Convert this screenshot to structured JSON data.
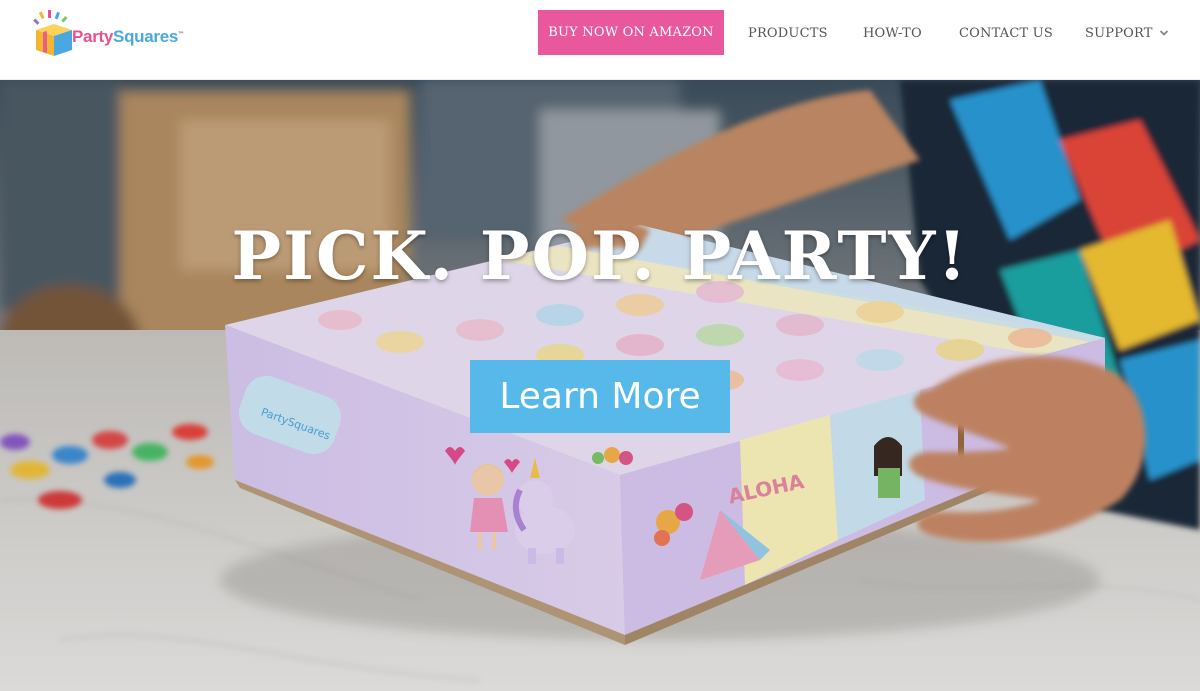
{
  "brand": {
    "logo_part1": "Party",
    "logo_part2": "Squares",
    "trademark": "™",
    "colors": {
      "pink": "#e9589c",
      "blue": "#56b9ea",
      "logo_pink": "#e9508f",
      "logo_blue": "#4aa8e0"
    }
  },
  "nav": {
    "buy_label": "BUY NOW ON AMAZON",
    "products": "PRODUCTS",
    "howto": "HOW-TO",
    "contact": "CONTACT US",
    "support": "SUPPORT",
    "support_icon": "chevron-down-icon"
  },
  "hero": {
    "headline": "PICK. POP. PARTY!",
    "cta_label": "Learn More",
    "box_text": "ALOHA",
    "box_logo_text": "PartySquares"
  }
}
